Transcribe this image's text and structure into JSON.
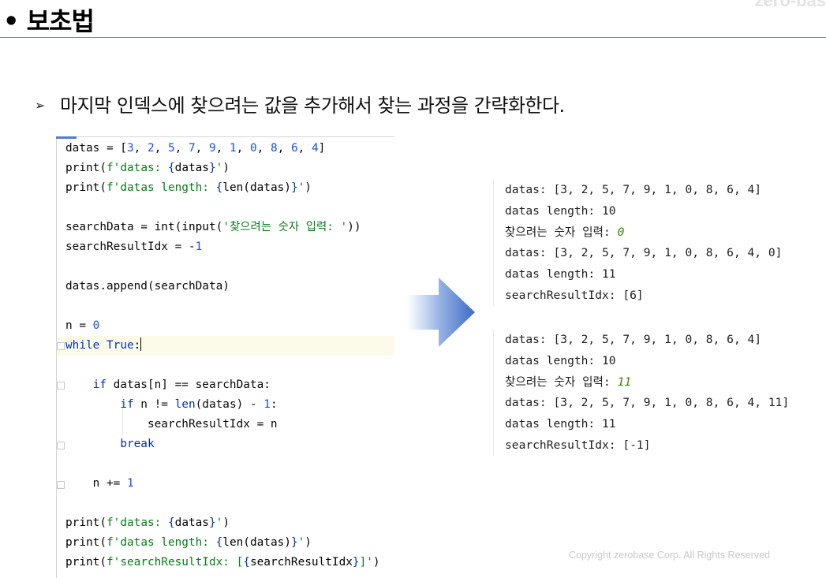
{
  "header": {
    "title": "• 보초법",
    "brand": "zero-bas"
  },
  "subtitle": {
    "bullet": "➢",
    "text": "마지막 인덱스에 찾으려는 값을 추가해서 찾는 과정을 간략화한다."
  },
  "code": {
    "lines": [
      "datas = [3, 2, 5, 7, 9, 1, 0, 8, 6, 4]",
      "print(f'datas: {datas}')",
      "print(f'datas length: {len(datas)}')",
      "",
      "searchData = int(input('찾으려는 숫자 입력: '))",
      "searchResultIdx = -1",
      "",
      "datas.append(searchData)",
      "",
      "n = 0",
      "while True:",
      "",
      "    if datas[n] == searchData:",
      "        if n != len(datas) - 1:",
      "            searchResultIdx = n",
      "        break",
      "",
      "    n += 1",
      "",
      "print(f'datas: {datas}')",
      "print(f'datas length: {len(datas)}')",
      "print(f'searchResultIdx: [{searchResultIdx}]')"
    ]
  },
  "outputs": [
    {
      "lines": [
        "datas: [3, 2, 5, 7, 9, 1, 0, 8, 6, 4]",
        "datas length: 10",
        "찾으려는 숫자 입력: ",
        "datas: [3, 2, 5, 7, 9, 1, 0, 8, 6, 4, 0]",
        "datas length: 11",
        "searchResultIdx: [6]"
      ],
      "user_input": "0"
    },
    {
      "lines": [
        "datas: [3, 2, 5, 7, 9, 1, 0, 8, 6, 4]",
        "datas length: 10",
        "찾으려는 숫자 입력: ",
        "datas: [3, 2, 5, 7, 9, 1, 0, 8, 6, 4, 11]",
        "datas length: 11",
        "searchResultIdx: [-1]"
      ],
      "user_input": "11"
    }
  ],
  "footer": {
    "copyright": "Copyright zerobase Corp. All Rights Reserved"
  },
  "colors": {
    "keyword": "#0033b3",
    "number": "#1750eb",
    "string": "#067d17",
    "input_text": "#2e8b00",
    "arrow": "#4a78c9"
  },
  "icons": {
    "arrow": "right-arrow-icon"
  }
}
